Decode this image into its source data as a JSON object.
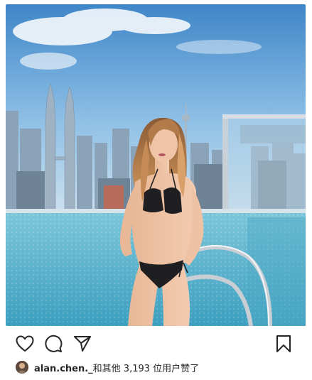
{
  "post": {
    "image_alt": "Woman in black bikini at rooftop infinity pool overlooking city skyline"
  },
  "actions": {
    "like_icon": "heart-outline-icon",
    "comment_icon": "comment-bubble-icon",
    "share_icon": "paper-plane-icon",
    "save_icon": "bookmark-icon"
  },
  "likes": {
    "username": "alan.chen._",
    "suffix": "和其他 3,193 位用户赞了"
  },
  "colors": {
    "text": "#262626",
    "sky_top": "#3f86c8",
    "pool": "#5fb7cf"
  }
}
